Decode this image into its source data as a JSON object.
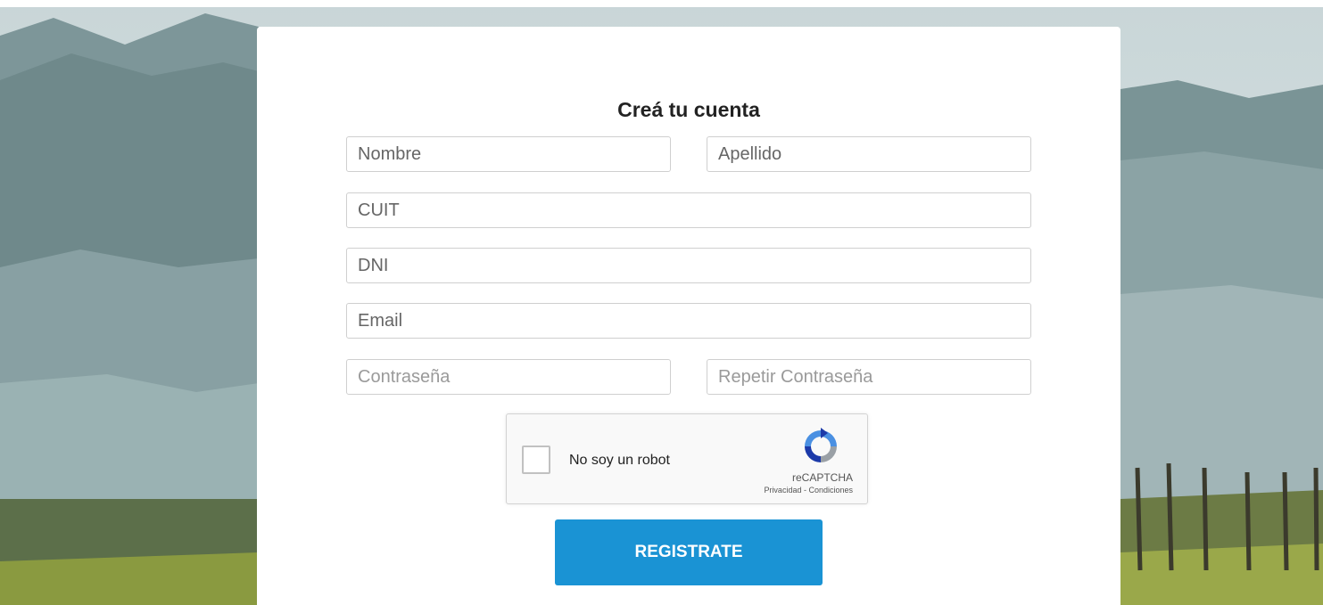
{
  "form": {
    "title": "Creá tu cuenta",
    "fields": {
      "nombre": {
        "placeholder": "Nombre",
        "value": ""
      },
      "apellido": {
        "placeholder": "Apellido",
        "value": ""
      },
      "cuit": {
        "placeholder": "CUIT",
        "value": ""
      },
      "dni": {
        "placeholder": "DNI",
        "value": ""
      },
      "email": {
        "placeholder": "Email",
        "value": ""
      },
      "password": {
        "placeholder": "Contraseña",
        "value": ""
      },
      "password_repeat": {
        "placeholder": "Repetir Contraseña",
        "value": ""
      }
    },
    "captcha": {
      "label": "No soy un robot",
      "brand": "reCAPTCHA",
      "links": "Privacidad - Condiciones",
      "icon": "recaptcha-icon",
      "checked": false
    },
    "submit_label": "REGISTRATE"
  },
  "colors": {
    "accent": "#1a93d4",
    "card": "#ffffff",
    "title": "#222222"
  }
}
